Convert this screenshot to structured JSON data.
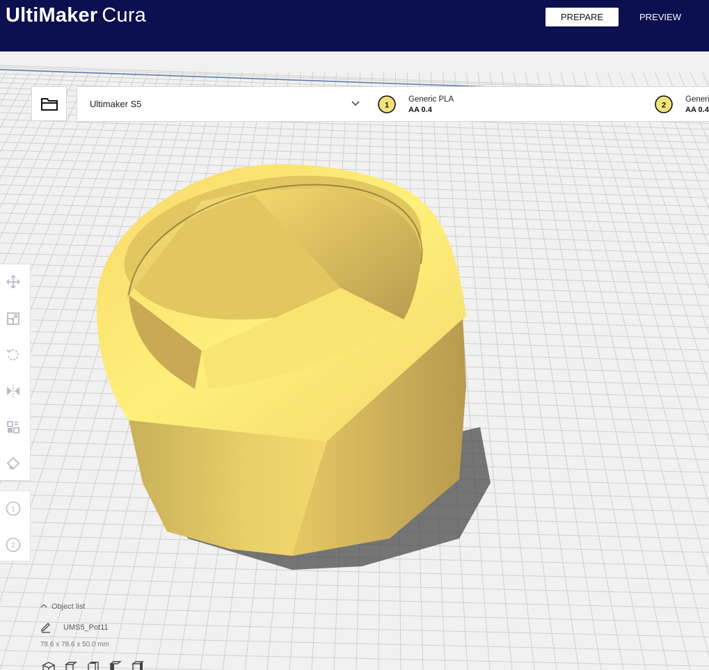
{
  "app": {
    "brand_bold": "UltiMaker",
    "brand_light": "Cura"
  },
  "stages": {
    "prepare": "PREPARE",
    "preview": "PREVIEW"
  },
  "printer": {
    "name": "Ultimaker S5"
  },
  "extruders": [
    {
      "number": "1",
      "material": "Generic PLA",
      "core": "AA 0.4"
    },
    {
      "number": "2",
      "material": "Generi",
      "core": "AA 0.4"
    }
  ],
  "side_extruders": [
    "1",
    "2"
  ],
  "object_list": {
    "header": "Object list",
    "object_name": "UMS5_Pot11",
    "dimensions": "78.6 x 78.6 x 50.0 mm"
  },
  "colors": {
    "topbar": "#0c1050",
    "model_yellow": "#f5e07a",
    "grid": "#c8c8c8"
  }
}
